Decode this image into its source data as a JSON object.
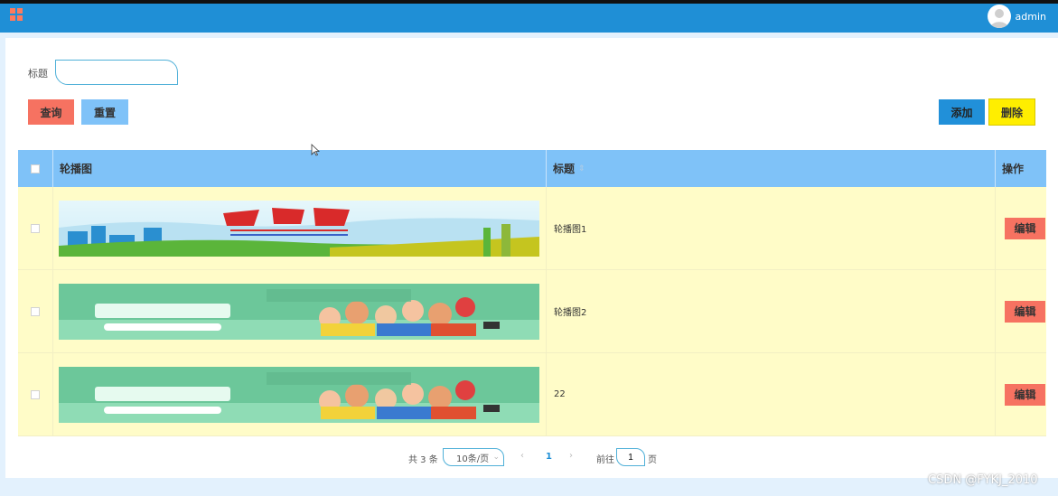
{
  "header": {
    "username": "admin",
    "menu_icon": "grid-menu-icon",
    "avatar_icon": "user-avatar-icon",
    "colors": {
      "bar": "#1f8fd6",
      "menu": "#ff7a5c"
    }
  },
  "search": {
    "label": "标题",
    "value": "",
    "placeholder": ""
  },
  "toolbar": {
    "query_label": "查询",
    "reset_label": "重置",
    "add_label": "添加",
    "delete_label": "删除",
    "colors": {
      "query": "#f67261",
      "reset": "#7fc2f8",
      "add": "#2190d9",
      "delete": "#ffee00"
    }
  },
  "table": {
    "columns": [
      "轮播图",
      "标题",
      "操作"
    ],
    "rows": [
      {
        "image": "student-union-banner",
        "title": "轮播图1",
        "edit_label": "编辑"
      },
      {
        "image": "community-banner",
        "title": "轮播图2",
        "edit_label": "编辑"
      },
      {
        "image": "community-banner",
        "title": "22",
        "edit_label": "编辑"
      }
    ],
    "colors": {
      "header": "#7fc2f8",
      "row": "#fffcc8",
      "edit": "#f67261"
    }
  },
  "pagination": {
    "total_text": "共 3 条",
    "page_size": "10条/页",
    "current_page": "1",
    "goto_label": "前往",
    "goto_value": "1",
    "page_suffix": "页"
  },
  "watermark": "CSDN @FYKJ_2010"
}
